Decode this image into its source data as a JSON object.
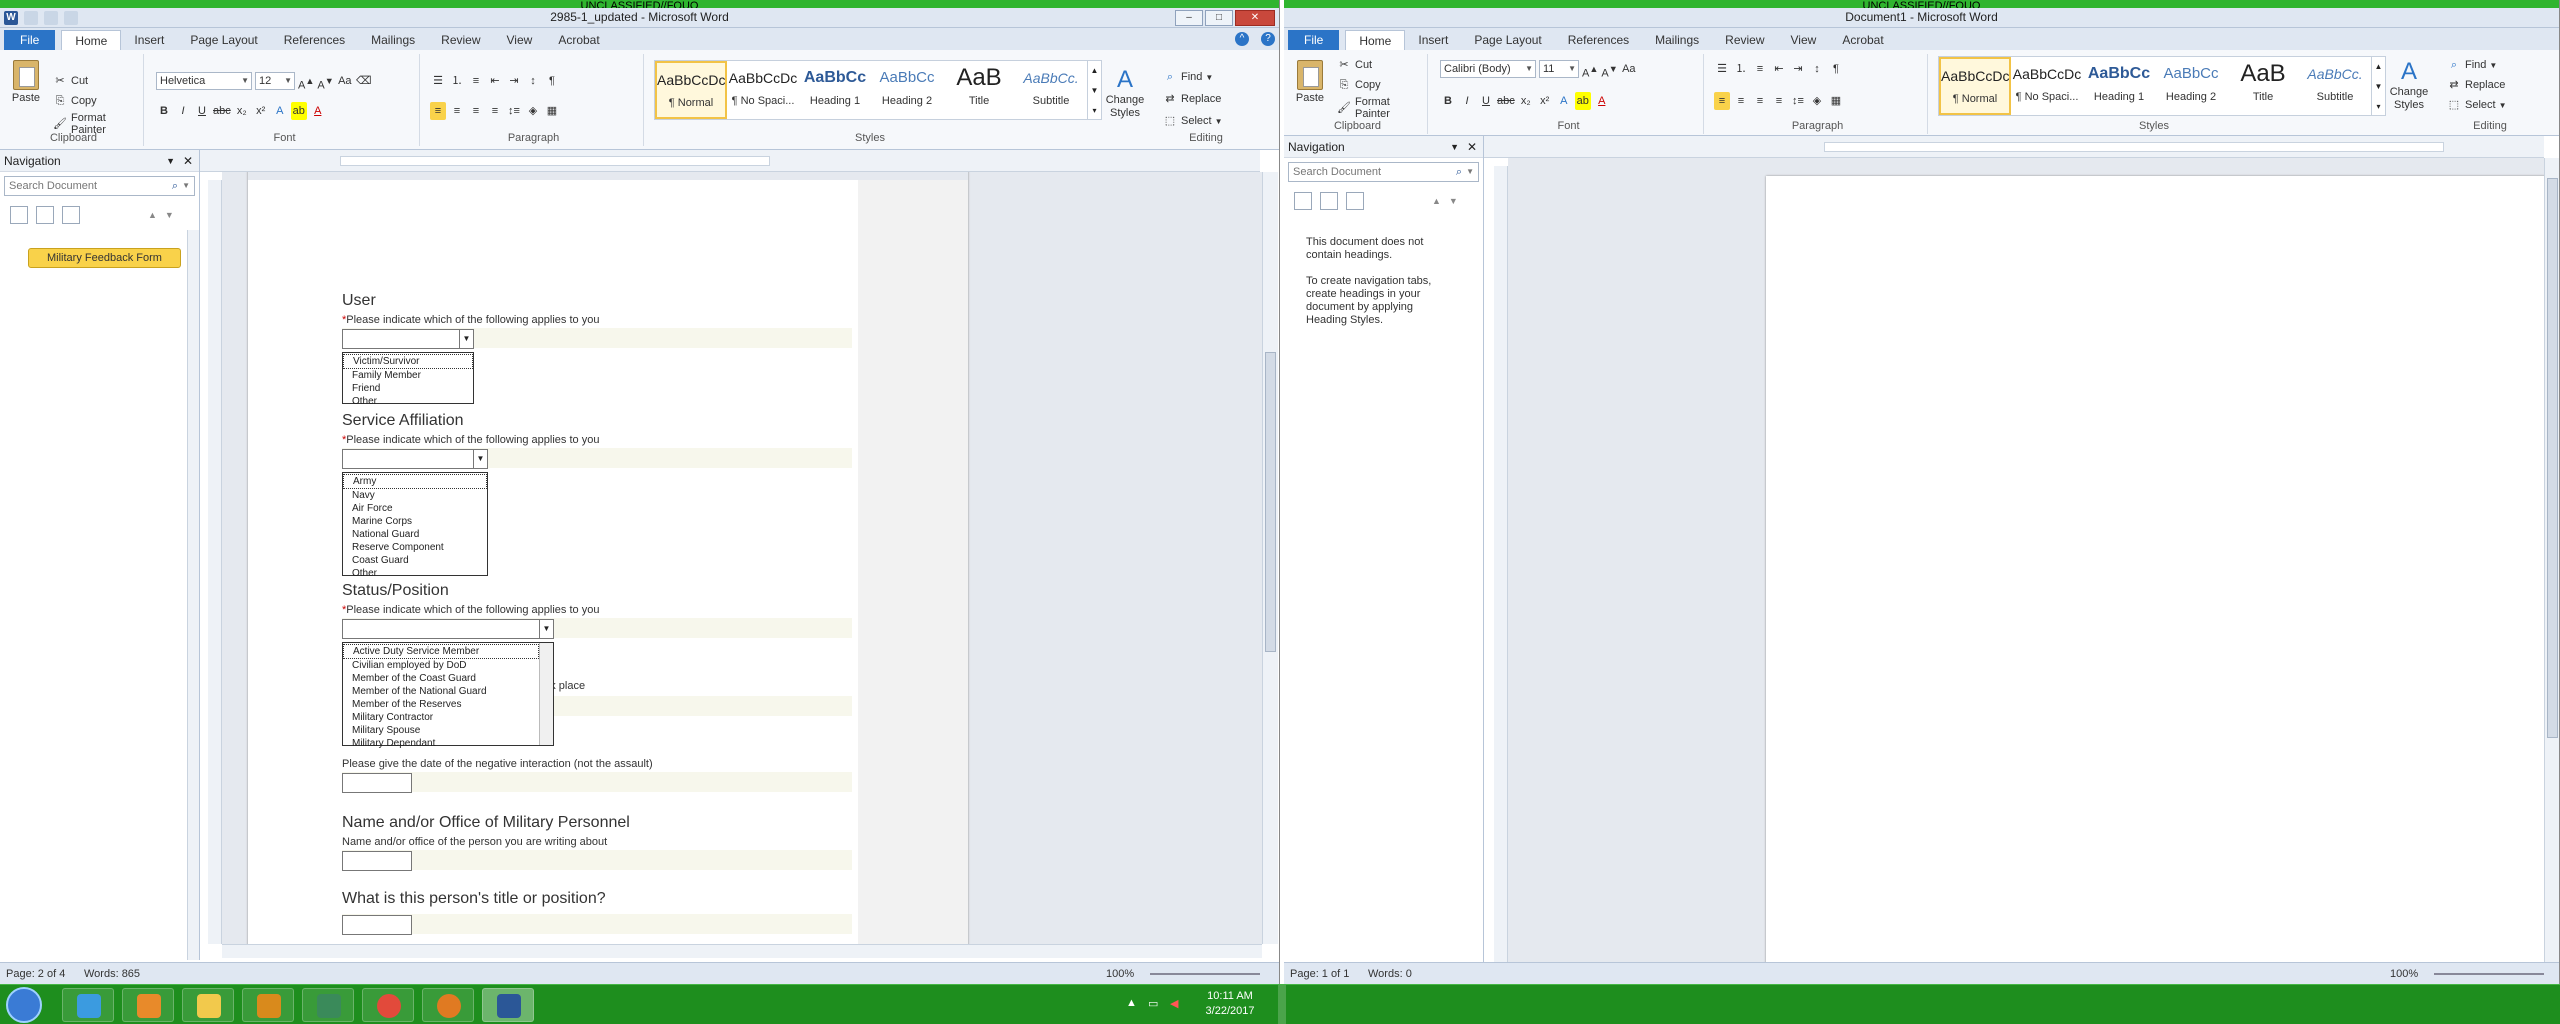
{
  "classification_banner": "UNCLASSIFIED//FOUO",
  "left_window": {
    "title": "2985-1_updated - Microsoft Word",
    "tabs": [
      "File",
      "Home",
      "Insert",
      "Page Layout",
      "References",
      "Mailings",
      "Review",
      "View",
      "Acrobat"
    ],
    "active_tab": "Home",
    "font_name": "Helvetica",
    "font_size": "12",
    "clipboard": {
      "paste": "Paste",
      "cut": "Cut",
      "copy": "Copy",
      "format_painter": "Format Painter",
      "label": "Clipboard"
    },
    "group_labels": {
      "font": "Font",
      "paragraph": "Paragraph",
      "styles": "Styles",
      "editing": "Editing"
    },
    "styles": [
      {
        "preview": "AaBbCcDc",
        "name": "¶ Normal"
      },
      {
        "preview": "AaBbCcDc",
        "name": "¶ No Spaci..."
      },
      {
        "preview": "AaBbCc",
        "name": "Heading 1"
      },
      {
        "preview": "AaBbCc",
        "name": "Heading 2"
      },
      {
        "preview": "AaB",
        "name": "Title"
      },
      {
        "preview": "AaBbCc.",
        "name": "Subtitle"
      }
    ],
    "change_styles": "Change Styles",
    "editing": {
      "find": "Find",
      "replace": "Replace",
      "select": "Select"
    },
    "nav": {
      "title": "Navigation",
      "search_placeholder": "Search Document",
      "heading": "Military Feedback Form"
    },
    "form": {
      "user_header": "User",
      "prompt": "Please indicate which of the following applies to you",
      "user_options": [
        "Victim/Survivor",
        "Family Member",
        "Friend",
        "Other"
      ],
      "service_header": "Service Affiliation",
      "service_options": [
        "Army",
        "Navy",
        "Air Force",
        "Marine Corps",
        "National Guard",
        "Reserve Component",
        "Coast Guard",
        "Other"
      ],
      "status_header": "Status/Position",
      "status_options": [
        "Active Duty Service Member",
        "Civilian employed by DoD",
        "Member of the Coast Guard",
        "Member of the National Guard",
        "Member of the Reserves",
        "Military Contractor",
        "Military Spouse",
        "Military Dependant"
      ],
      "took_place_fragment": "ook place",
      "date_prompt": "Please give the date of the negative interaction (not the assault)",
      "name_header": "Name and/or Office of Military Personnel",
      "name_prompt": "Name and/or office of the person you are writing about",
      "title_header": "What is this person's title or position?"
    },
    "status": {
      "page": "Page: 2 of 4",
      "words": "Words: 865",
      "zoom": "100%"
    }
  },
  "right_window": {
    "title": "Document1 - Microsoft Word",
    "tabs": [
      "File",
      "Home",
      "Insert",
      "Page Layout",
      "References",
      "Mailings",
      "Review",
      "View",
      "Acrobat"
    ],
    "font_name": "Calibri (Body)",
    "font_size": "11",
    "nav": {
      "title": "Navigation",
      "search_placeholder": "Search Document",
      "msg1": "This document does not contain headings.",
      "msg2": "To create navigation tabs, create headings in your document by applying Heading Styles."
    },
    "status": {
      "page": "Page: 1 of 1",
      "words": "Words: 0",
      "zoom": "100%"
    }
  },
  "taskbar": {
    "time": "10:11 AM",
    "date": "3/22/2017"
  }
}
